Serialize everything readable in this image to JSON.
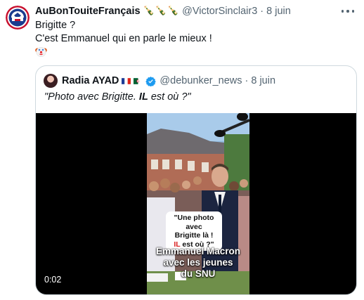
{
  "tweet": {
    "display_name": "AuBonTouiteFrançais",
    "name_emojis": "🍾🍾🍾",
    "handle": "@VictorSinclair3",
    "separator": "·",
    "date": "8 juin",
    "text_lines": [
      "Brigitte ?",
      "C'est Emmanuel qui en parle le mieux !"
    ],
    "trailing_emoji": "clown-face"
  },
  "quote": {
    "display_name": "Radia AYAD",
    "handle": "@debunker_news",
    "separator": "·",
    "date": "8 juin",
    "flags": [
      "france-flag",
      "algeria-flag"
    ],
    "verified": true,
    "text_parts": {
      "pre": "\"Photo avec Brigitte. ",
      "bold": "IL",
      "post": " est où  ?\""
    },
    "video": {
      "bubble_line1": "\"Une photo avec",
      "bubble_line2": "Brigitte là !",
      "bubble_il": "IL",
      "bubble_line3_rest": " est où ?\"",
      "caption_line1": "Emmanuel Macron",
      "caption_line2": "avec les jeunes",
      "caption_line3": "du SNU",
      "duration": "0:02"
    }
  },
  "colors": {
    "text_primary": "#0f1419",
    "text_secondary": "#536471",
    "border": "#cfd9de",
    "verified_blue": "#1d9bf0",
    "video_bg": "#000000",
    "bubble_red": "#d91f1f"
  }
}
